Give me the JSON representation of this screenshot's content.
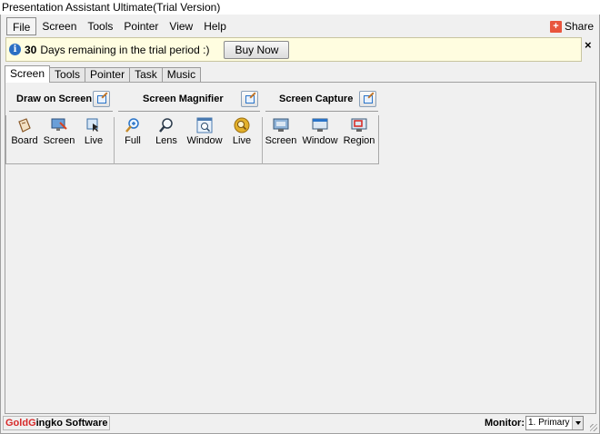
{
  "window": {
    "title": "Presentation Assistant Ultimate(Trial Version)"
  },
  "menubar": {
    "items": [
      "File",
      "Screen",
      "Tools",
      "Pointer",
      "View",
      "Help"
    ],
    "share_label": "Share"
  },
  "trial": {
    "days": "30",
    "message": "Days remaining in the trial period :)",
    "buy_label": "Buy Now",
    "close": "×"
  },
  "tabs": [
    "Screen",
    "Tools",
    "Pointer",
    "Task",
    "Music"
  ],
  "groups": {
    "draw": {
      "title": "Draw on Screen",
      "tools": [
        {
          "label": "Board",
          "icon": "board-icon"
        },
        {
          "label": "Screen",
          "icon": "screen-draw-icon"
        },
        {
          "label": "Live",
          "icon": "live-draw-icon"
        }
      ]
    },
    "magnifier": {
      "title": "Screen Magnifier",
      "tools": [
        {
          "label": "Full",
          "icon": "zoom-in-icon"
        },
        {
          "label": "Lens",
          "icon": "magnifier-icon"
        },
        {
          "label": "Window",
          "icon": "window-zoom-icon"
        },
        {
          "label": "Live",
          "icon": "live-zoom-icon"
        }
      ]
    },
    "capture": {
      "title": "Screen Capture",
      "tools": [
        {
          "label": "Screen",
          "icon": "capture-screen-icon"
        },
        {
          "label": "Window",
          "icon": "capture-window-icon"
        },
        {
          "label": "Region",
          "icon": "capture-region-icon"
        }
      ]
    }
  },
  "status": {
    "brand_gold": "Gold",
    "brand_g": "G",
    "brand_rest": "ingko Software",
    "monitor_label": "Monitor:",
    "monitor_value": "1. Primary M"
  },
  "colors": {
    "trial_bg": "#fffde0",
    "brand_red": "#d72a2a",
    "accent_blue": "#2a74c8"
  }
}
